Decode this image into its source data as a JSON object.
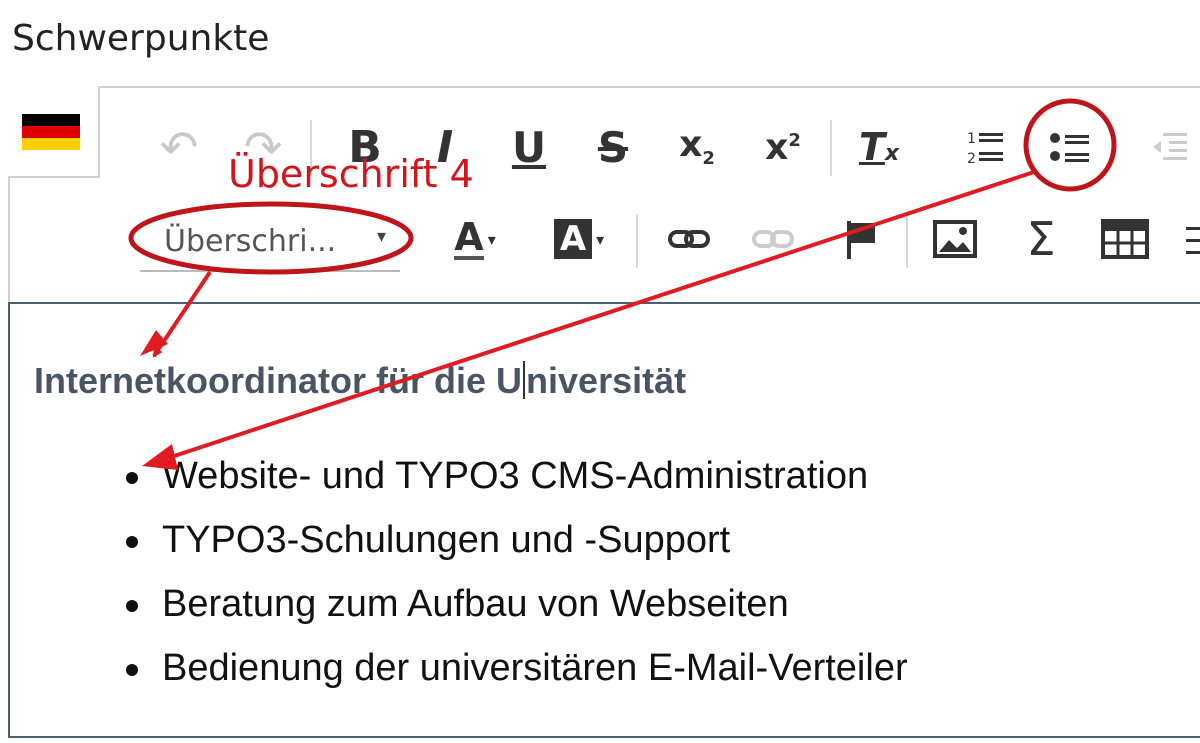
{
  "field": {
    "label": "Schwerpunkte"
  },
  "language": {
    "flag": "german-flag-icon",
    "colors": [
      "#000000",
      "#dd0000",
      "#ffce00"
    ]
  },
  "toolbar": {
    "row1": [
      {
        "name": "undo-icon",
        "glyph": "↶",
        "disabled": true
      },
      {
        "name": "redo-icon",
        "glyph": "↷",
        "disabled": true
      },
      {
        "name": "bold-button",
        "glyph": "B"
      },
      {
        "name": "italic-button",
        "glyph": "I"
      },
      {
        "name": "underline-button",
        "glyph": "U"
      },
      {
        "name": "strikethrough-button",
        "glyph": "S"
      },
      {
        "name": "subscript-button",
        "glyph": "x₂"
      },
      {
        "name": "superscript-button",
        "glyph": "x²"
      },
      {
        "name": "remove-format-button",
        "glyph": "Tx"
      },
      {
        "name": "numbered-list-button",
        "glyph": "1≡"
      },
      {
        "name": "bulleted-list-button",
        "glyph": "•≡"
      },
      {
        "name": "outdent-button",
        "glyph": "⇤",
        "disabled": true
      }
    ],
    "format_select": {
      "value": "Überschri...",
      "caret": "▾"
    },
    "row2": [
      {
        "name": "text-color-button",
        "glyph": "A▾"
      },
      {
        "name": "background-color-button",
        "glyph": "A▾"
      },
      {
        "name": "link-button",
        "glyph": "🔗"
      },
      {
        "name": "unlink-button",
        "glyph": "⛓",
        "disabled": true
      },
      {
        "name": "anchor-button",
        "glyph": "⚑"
      },
      {
        "name": "image-button",
        "glyph": "🖼"
      },
      {
        "name": "math-button",
        "glyph": "Σ"
      },
      {
        "name": "table-button",
        "glyph": "▦"
      }
    ]
  },
  "annotation": {
    "label": "Überschrift 4",
    "color": "#d0161b"
  },
  "content": {
    "heading_before_cursor": "Internetkoordinator für die U",
    "heading_after_cursor": "niversität",
    "items": [
      "Website- und TYPO3 CMS-Administration",
      "TYPO3-Schulungen und -Support",
      "Beratung zum Aufbau von Webseiten",
      "Bedienung der universitären E-Mail-Verteiler"
    ]
  }
}
